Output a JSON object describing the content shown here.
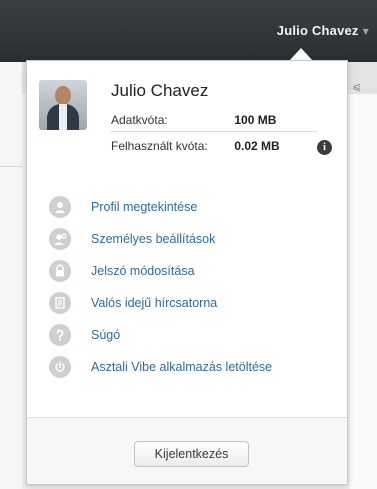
{
  "topbar": {
    "user_label": "Julio Chavez"
  },
  "user": {
    "name": "Julio Chavez",
    "quota_label": "Adatkvóta:",
    "quota_value": "100 MB",
    "used_label": "Felhasznált kvóta:",
    "used_value": "0.02 MB"
  },
  "menu": {
    "items": [
      {
        "label": "Profil megtekintése",
        "icon": "profile-icon"
      },
      {
        "label": "Személyes beállítások",
        "icon": "user-settings-icon"
      },
      {
        "label": "Jelszó módosítása",
        "icon": "lock-icon"
      },
      {
        "label": "Valós idejű hírcsatorna",
        "icon": "news-feed-icon"
      },
      {
        "label": "Súgó",
        "icon": "help-icon"
      },
      {
        "label": "Asztali Vibe alkalmazás letöltése",
        "icon": "download-icon"
      }
    ]
  },
  "footer": {
    "logout_label": "Kijelentkezés"
  },
  "colors": {
    "link": "#2f6d97",
    "topbar": "#2f3335",
    "icon_gray": "#cfcfcf"
  }
}
